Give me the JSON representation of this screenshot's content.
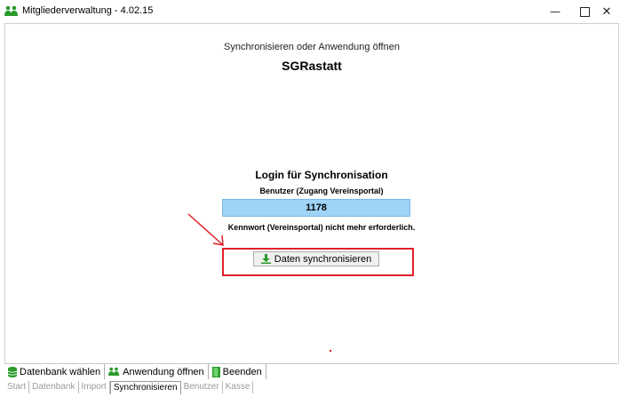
{
  "window": {
    "title": "Mitgliederverwaltung  - 4.02.15",
    "minimize": "—",
    "close": "✕"
  },
  "main": {
    "subtitle": "Synchronisieren oder Anwendung öffnen",
    "org_name": "SGRastatt",
    "login_heading": "Login für Synchronisation",
    "user_label": "Benutzer (Zugang Vereinsportal)",
    "user_value": "1178",
    "password_note": "Kennwort (Vereinsportal) nicht mehr erforderlich.",
    "sync_button": "Daten synchronisieren"
  },
  "toolbar": {
    "items": [
      {
        "label": "Datenbank wählen",
        "icon": "database-icon"
      },
      {
        "label": "Anwendung öffnen",
        "icon": "people-icon"
      },
      {
        "label": "Beenden",
        "icon": "door-icon"
      }
    ]
  },
  "tabs": [
    "Start",
    "Datenbank",
    "Import",
    "Synchronisieren",
    "Benutzer",
    "Kasse"
  ],
  "active_tab": "Synchronisieren",
  "colors": {
    "user_field_bg": "#9fd4f7",
    "annotation_red": "#e0202a",
    "icon_green": "#2a9a2a"
  }
}
